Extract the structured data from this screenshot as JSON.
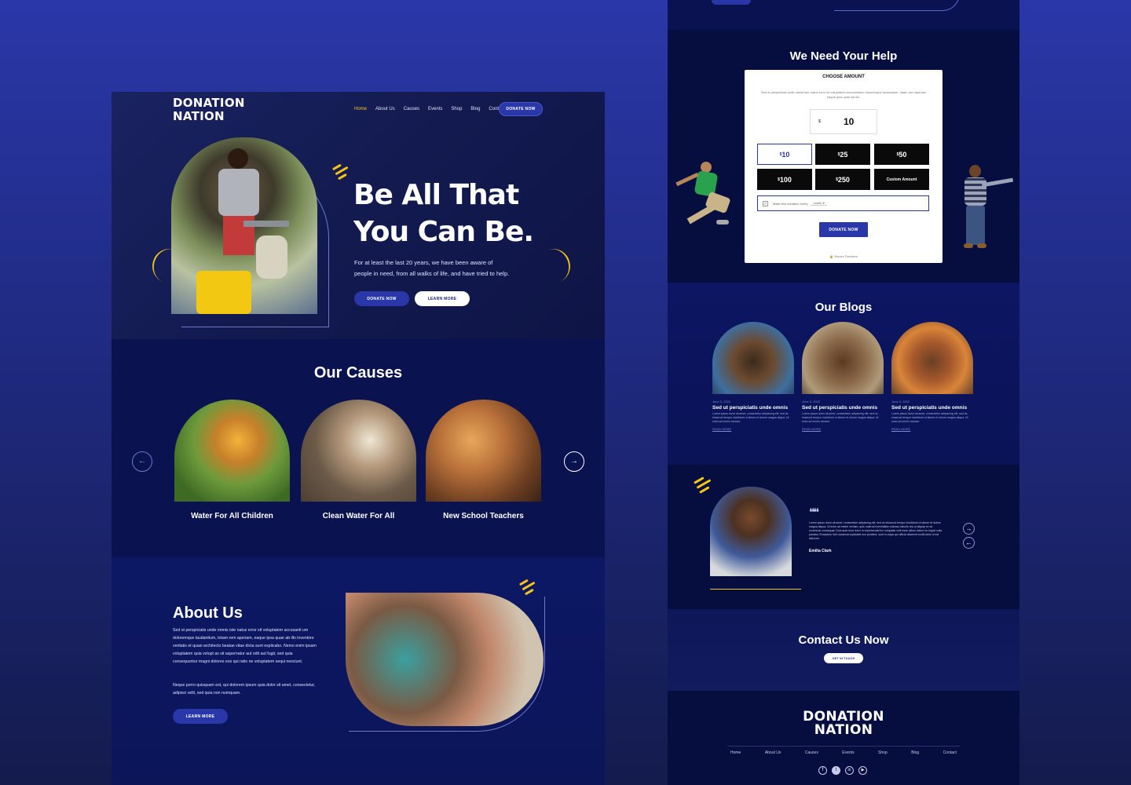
{
  "brand": {
    "line1": "DONATION",
    "line2": "NATION"
  },
  "nav": {
    "items": [
      "Home",
      "About Us",
      "Causes",
      "Events",
      "Shop",
      "Blog",
      "Contact"
    ],
    "cta": "DONATE NOW"
  },
  "hero": {
    "title1": "Be All That",
    "title2": "You Can Be.",
    "text1": "For at least the last 20 years, we have been aware of",
    "text2": "people in need, from all walks of life, and have tried to help.",
    "btn_donate": "DONATE NOW",
    "btn_learn": "LEARN MORE"
  },
  "causes": {
    "heading": "Our Causes",
    "items": [
      {
        "title": "Water For All Children"
      },
      {
        "title": "Clean Water For All"
      },
      {
        "title": "New School Teachers"
      }
    ]
  },
  "about": {
    "heading": "About Us",
    "p1": "Sed ut perspiciatis unde omnis iste natus error sit voluptatem accusanti um doloremque laudantium, totam rem aperiam, eaque ipsa quae ab illo inventore veritatis et quasi architecto beatae vitae dicta sunt explicabo. Nemo enim ipsam voluptatem quia volupt as sit aspernatur aut odit aut fugit, sed quia consequuntur magni dolores eos qui ratio ne voluptatem sequi nesciunt.",
    "p2": "Neque porro quisquam est, qui dolorem ipsum quia dolor sit amet, consectetur, adipisci velit, sed quia non numquam.",
    "btn": "LEARN MORE"
  },
  "help": {
    "heading": "We Need Your Help",
    "form_title": "CHOOSE AMOUNT",
    "form_desc": "Sed ut perspiciatis unde omnis iste natus error sit voluptatem accusantium doloremque laudantium, totam rem aperiam eaque ipsa quae ab illo.",
    "currency": "$",
    "amount": "10",
    "options": [
      "10",
      "25",
      "50",
      "100",
      "250"
    ],
    "custom": "Custom Amount",
    "recurring": "Make this donation every",
    "period": "month",
    "submit": "DONATE NOW",
    "secure": "Secure Donation"
  },
  "blogs": {
    "heading": "Our Blogs",
    "items": [
      {
        "date": "June 3, 2022",
        "title": "Sed ut perspiciatis unde omnis",
        "excerpt": "Lorem ipsum dolor sit amet, consectetur adipiscing elit, sed do eiusmod tempor incididunt ut labore et dolore magna aliqua. Ut enim ad minim veniam.",
        "more": "READ MORE"
      },
      {
        "date": "June 3, 2022",
        "title": "Sed ut perspiciatis unde omnis",
        "excerpt": "Lorem ipsum dolor sit amet, consectetur adipiscing elit, sed do eiusmod tempor incididunt ut labore et dolore magna aliqua. Ut enim ad minim veniam.",
        "more": "READ MORE"
      },
      {
        "date": "June 3, 2022",
        "title": "Sed ut perspiciatis unde omnis",
        "excerpt": "Lorem ipsum dolor sit amet, consectetur adipiscing elit, sed do eiusmod tempor incididunt ut labore et dolore magna aliqua. Ut enim ad minim veniam.",
        "more": "READ MORE"
      }
    ]
  },
  "testimonial": {
    "quote": "Lorem ipsum dolor sit amet, consectetur adipiscing elit, sed do eiusmod tempor incididunt ut labore et dolore magna aliqua. Ut enim ad minim veniam, quis nostrud exercitation ullamco laboris nisi ut aliquip ex ea commodo consequat. Duis aute irure dolor in reprehenderit in voluptate velit esse cillum dolore eu fugiat nulla pariatur. Excepteur sint occaecat cupidatat non proident, sunt in culpa qui officia deserunt mollit anim id est laborum.",
    "name": "Emilia Clark"
  },
  "contact": {
    "heading": "Contact Us Now",
    "btn": "GET IN TOUCH"
  },
  "footer": {
    "nav": [
      "Home",
      "About Us",
      "Causes",
      "Events",
      "Shop",
      "Blog",
      "Contact"
    ],
    "social": [
      "facebook-icon",
      "twitter-icon",
      "linkedin-icon",
      "youtube-icon"
    ]
  },
  "colors": {
    "accent": "#f5c518",
    "primary": "#2a37a8",
    "panel": "#0b1350"
  }
}
